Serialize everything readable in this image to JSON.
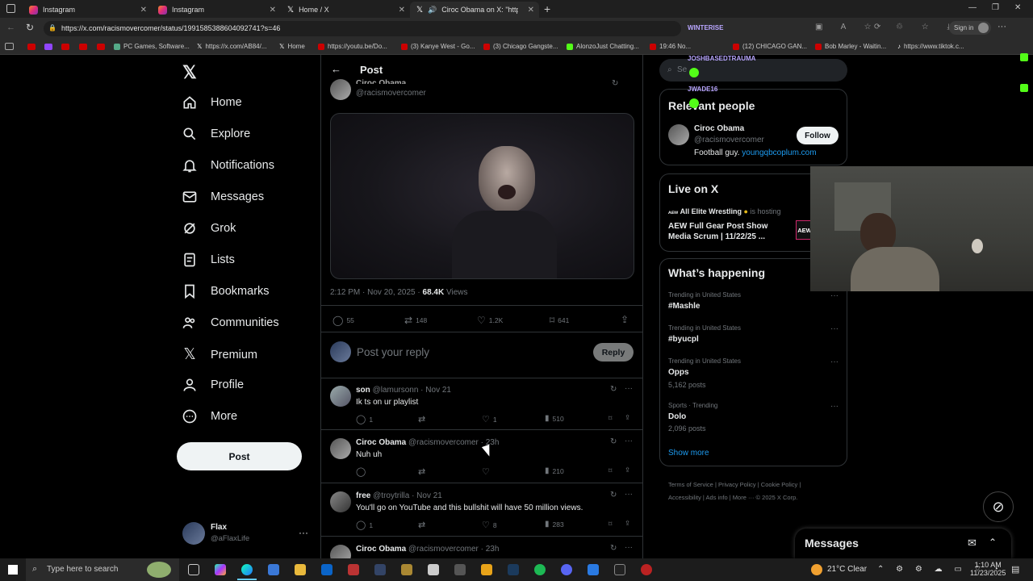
{
  "browser": {
    "tabs": [
      {
        "title": "Instagram"
      },
      {
        "title": "Instagram"
      },
      {
        "title": "Home / X"
      },
      {
        "title": "Ciroc Obama on X: \"https://"
      }
    ],
    "url": "https://x.com/racismovercomer/status/1991585388604092741?s=46",
    "sign_in": "Sign in",
    "bookmarks": [
      "PC Games, Software...",
      "https://x.com/AB84/...",
      "Home",
      "https://youtu.be/Do...",
      "(3) Kanye West - Go...",
      "(3) Chicago Gangste...",
      "AlonzoJust Chatting...",
      "19:46 No...",
      "(12) CHICAGO GAN...",
      "Bob Marley - Waitin...",
      "https://www.tiktok.c..."
    ]
  },
  "chat_overlay": [
    "WINTERISE",
    "JOSHBASEDTRAUMA",
    "JWADE16"
  ],
  "nav": {
    "items": [
      "Home",
      "Explore",
      "Notifications",
      "Messages",
      "Grok",
      "Lists",
      "Bookmarks",
      "Communities",
      "Premium",
      "Profile",
      "More"
    ],
    "post_label": "Post",
    "account_name": "Flax",
    "account_handle": "@aFlaxLife"
  },
  "post": {
    "header_title": "Post",
    "author_name": "Ciroc Obama",
    "author_handle": "@racismovercomer",
    "time": "2:12 PM · Nov 20, 2025 ·",
    "views_count": "68.4K",
    "views_label": "Views",
    "replies": "55",
    "reposts": "148",
    "likes": "1.2K",
    "bookmarks": "641",
    "reply_placeholder": "Post your reply",
    "reply_button": "Reply"
  },
  "replies": [
    {
      "name": "son",
      "handle": "@lamursonn · Nov 21",
      "text": "Ik ts on ur playlist",
      "replies": "1",
      "likes": "1",
      "views": "510"
    },
    {
      "name": "Ciroc Obama",
      "handle": "@racismovercomer · 23h",
      "text": "Nuh uh",
      "replies": "",
      "likes": "",
      "views": "210"
    },
    {
      "name": "free",
      "handle": "@troytrilla · Nov 21",
      "text": "You'll go on YouTube and this bullshit will have 50 million views.",
      "replies": "1",
      "likes": "8",
      "views": "283"
    },
    {
      "name": "Ciroc Obama",
      "handle": "@racismovercomer · 23h",
      "text": "",
      "replies": "",
      "likes": "",
      "views": ""
    }
  ],
  "sidebar": {
    "search_placeholder": "Se",
    "relevant_title": "Relevant people",
    "person_name": "Ciroc Obama",
    "person_handle": "@racismovercomer",
    "person_bio": "Football guy.",
    "person_link": "youngqbcoplum.com",
    "follow_label": "Follow",
    "live_title": "Live on X",
    "live_host": "All Elite Wrestling",
    "live_hosting": "is hosting",
    "live_show": "AEW Full Gear Post Show Media Scrum | 11/22/25 ...",
    "live_badge": "AEW",
    "happening_title": "What’s happening",
    "trends": [
      {
        "sub": "Trending in United States",
        "name": "#Mashle",
        "posts": ""
      },
      {
        "sub": "Trending in United States",
        "name": "#byucpl",
        "posts": ""
      },
      {
        "sub": "Trending in United States",
        "name": "Opps",
        "posts": "5,162 posts"
      },
      {
        "sub": "Sports · Trending",
        "name": "Dolo",
        "posts": "2,096 posts"
      }
    ],
    "show_more": "Show more",
    "footer": [
      "Terms of Service",
      "Privacy Policy",
      "Cookie Policy",
      "Accessibility",
      "Ads info",
      "More ···",
      "© 2025 X Corp."
    ]
  },
  "messages_dock": {
    "title": "Messages"
  },
  "taskbar": {
    "search_placeholder": "Type here to search",
    "weather": "21°C  Clear",
    "time": "1:10 AM",
    "date": "11/23/2025"
  }
}
